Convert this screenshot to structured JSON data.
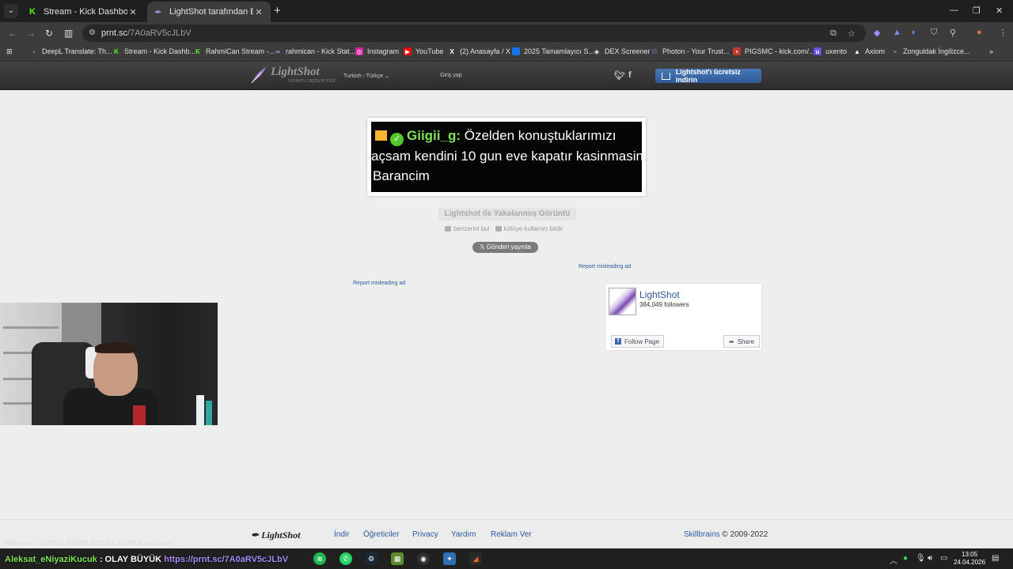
{
  "browser": {
    "tabs": [
      {
        "title": "Stream - Kick Dashboard",
        "favicon": "kick-icon",
        "active": false
      },
      {
        "title": "LightShot tarafından Ekran Görü",
        "favicon": "lightshot-icon",
        "active": true
      }
    ],
    "url_host": "prnt.sc",
    "url_path": "/7A0aRV5cJLbV",
    "bookmarks": [
      {
        "label": "DeepL Translate: Th...",
        "icon": "deepl-icon"
      },
      {
        "label": "Stream - Kick Dashb...",
        "icon": "kick-icon"
      },
      {
        "label": "RahmiCan Stream -...",
        "icon": "kick-icon"
      },
      {
        "label": "rahmican - Kick Stat...",
        "icon": "kickstat-icon"
      },
      {
        "label": "Instagram",
        "icon": "instagram-icon"
      },
      {
        "label": "YouTube",
        "icon": "youtube-icon"
      },
      {
        "label": "(2) Anasayfa / X",
        "icon": "x-icon"
      },
      {
        "label": "2025 Tamamlayıcı S...",
        "icon": "bookmark-icon"
      },
      {
        "label": "DEX Screener",
        "icon": "dexscreener-icon"
      },
      {
        "label": "Photon - Your Trust...",
        "icon": "photon-icon"
      },
      {
        "label": "PIGSMC - kick.com/...",
        "icon": "pigsmc-icon"
      },
      {
        "label": "uxento",
        "icon": "uxento-icon"
      },
      {
        "label": "Axiom",
        "icon": "axiom-icon"
      },
      {
        "label": "Zonguldak İngilizce...",
        "icon": "bookmark-icon"
      }
    ]
  },
  "lightshot": {
    "logo_text": "LightShot",
    "logo_sub": "screen capture tool",
    "language": "Turkish - Türkçe",
    "login": "Giriş yap",
    "download_button": "Lightshot'ı ücretsiz indirin",
    "screenshot": {
      "username": "Giigii_g:",
      "line1": " Özelden konuştuklarımızı",
      "line2": "açsam kendini 10 gun eve kapatır kasinmasin",
      "line3": "Barancim"
    },
    "caption": "Lightshot ile Yakalanmış Görüntü",
    "find_similar": "benzerini bul",
    "report_abuse": "kötüye kullanım bildir",
    "tweet_button": "Gönderi yayınla",
    "report_ad": "Report misleading ad",
    "facebook": {
      "page_name": "LightShot",
      "followers": "384,049 followers",
      "follow_button": "Follow Page",
      "share_button": "Share"
    },
    "footer": {
      "logo": "LightShot",
      "links": [
        "İndir",
        "Öğreticiler",
        "Privacy",
        "Yardım",
        "Reklam Ver"
      ],
      "company": "Skillbrains",
      "copyright": " © 2009-2022"
    }
  },
  "overlay": {
    "faint_text": "Nereden : ÜCRET YAYINI ACCAK İŞ ARA yüklüyor",
    "stream_name": "Aleksat_eNiyaziKucuk",
    "stream_title": " : OLAY BÜYÜK",
    "stream_url": " https://prnt.sc/7A0aRV5cJLbV"
  },
  "taskbar": {
    "time": "13:05",
    "date": "24.04.2026"
  }
}
